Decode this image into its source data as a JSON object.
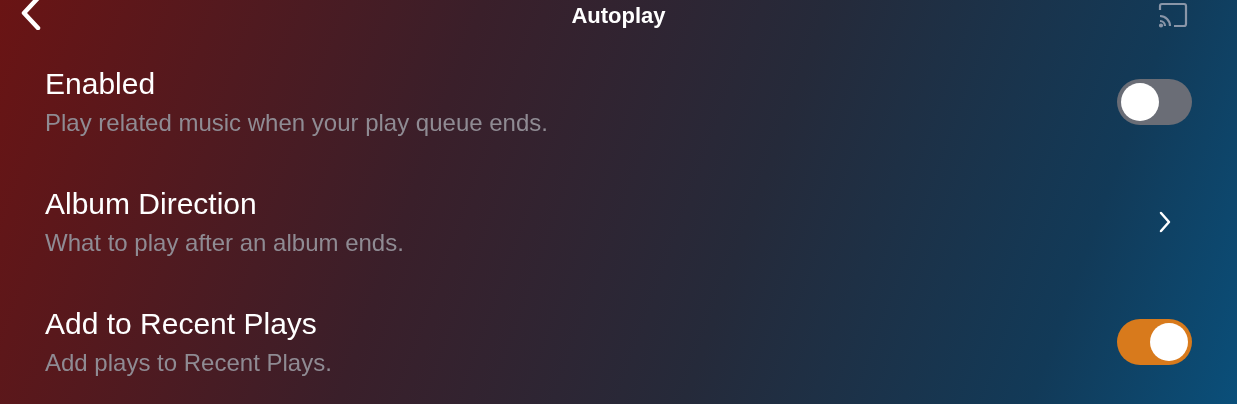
{
  "header": {
    "title": "Autoplay"
  },
  "rows": [
    {
      "kind": "toggle",
      "title": "Enabled",
      "subtitle": "Play related music when your play queue ends.",
      "on": false
    },
    {
      "kind": "link",
      "title": "Album Direction",
      "subtitle": "What to play after an album ends."
    },
    {
      "kind": "toggle",
      "title": "Add to Recent Plays",
      "subtitle": "Add plays to Recent Plays.",
      "on": true
    }
  ]
}
